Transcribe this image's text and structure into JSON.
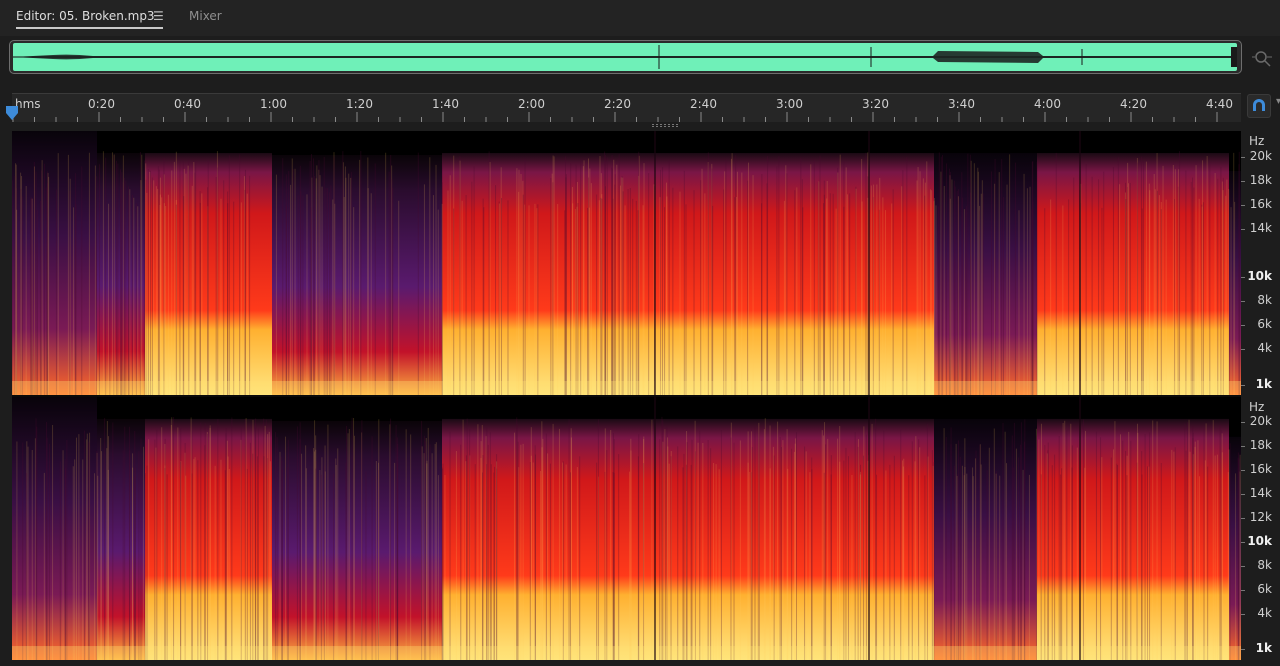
{
  "tabs": {
    "editor_label": "Editor: 05. Broken.mp3",
    "menu_glyph": "☰",
    "mixer_label": "Mixer"
  },
  "ruler": {
    "format_label": "hms",
    "ticks": [
      "0:20",
      "0:40",
      "1:00",
      "1:20",
      "1:40",
      "2:00",
      "2:20",
      "2:40",
      "3:00",
      "3:20",
      "3:40",
      "4:00",
      "4:20",
      "4:40"
    ]
  },
  "spectral_axis": {
    "unit": "Hz",
    "channel1": [
      "20k",
      "18k",
      "16k",
      "14k",
      "10k",
      "8k",
      "6k",
      "4k",
      "1k"
    ],
    "channel2": [
      "20k",
      "18k",
      "16k",
      "14k",
      "12k",
      "10k",
      "8k",
      "6k",
      "4k",
      "1k"
    ],
    "bold_labels": [
      "10k",
      "1k"
    ]
  },
  "colors": {
    "waveform": "#6ff0b8",
    "accent_blue": "#3d8bd9",
    "spectrum_low": "#ffe680",
    "spectrum_mid": "#ff3a1a",
    "spectrum_high": "#5a1a6e"
  },
  "icons": {
    "playhead": "playhead-marker-icon",
    "snap": "snap-magnet-icon",
    "zoom": "zoom-scroll-icon",
    "menu": "hamburger-menu-icon"
  }
}
